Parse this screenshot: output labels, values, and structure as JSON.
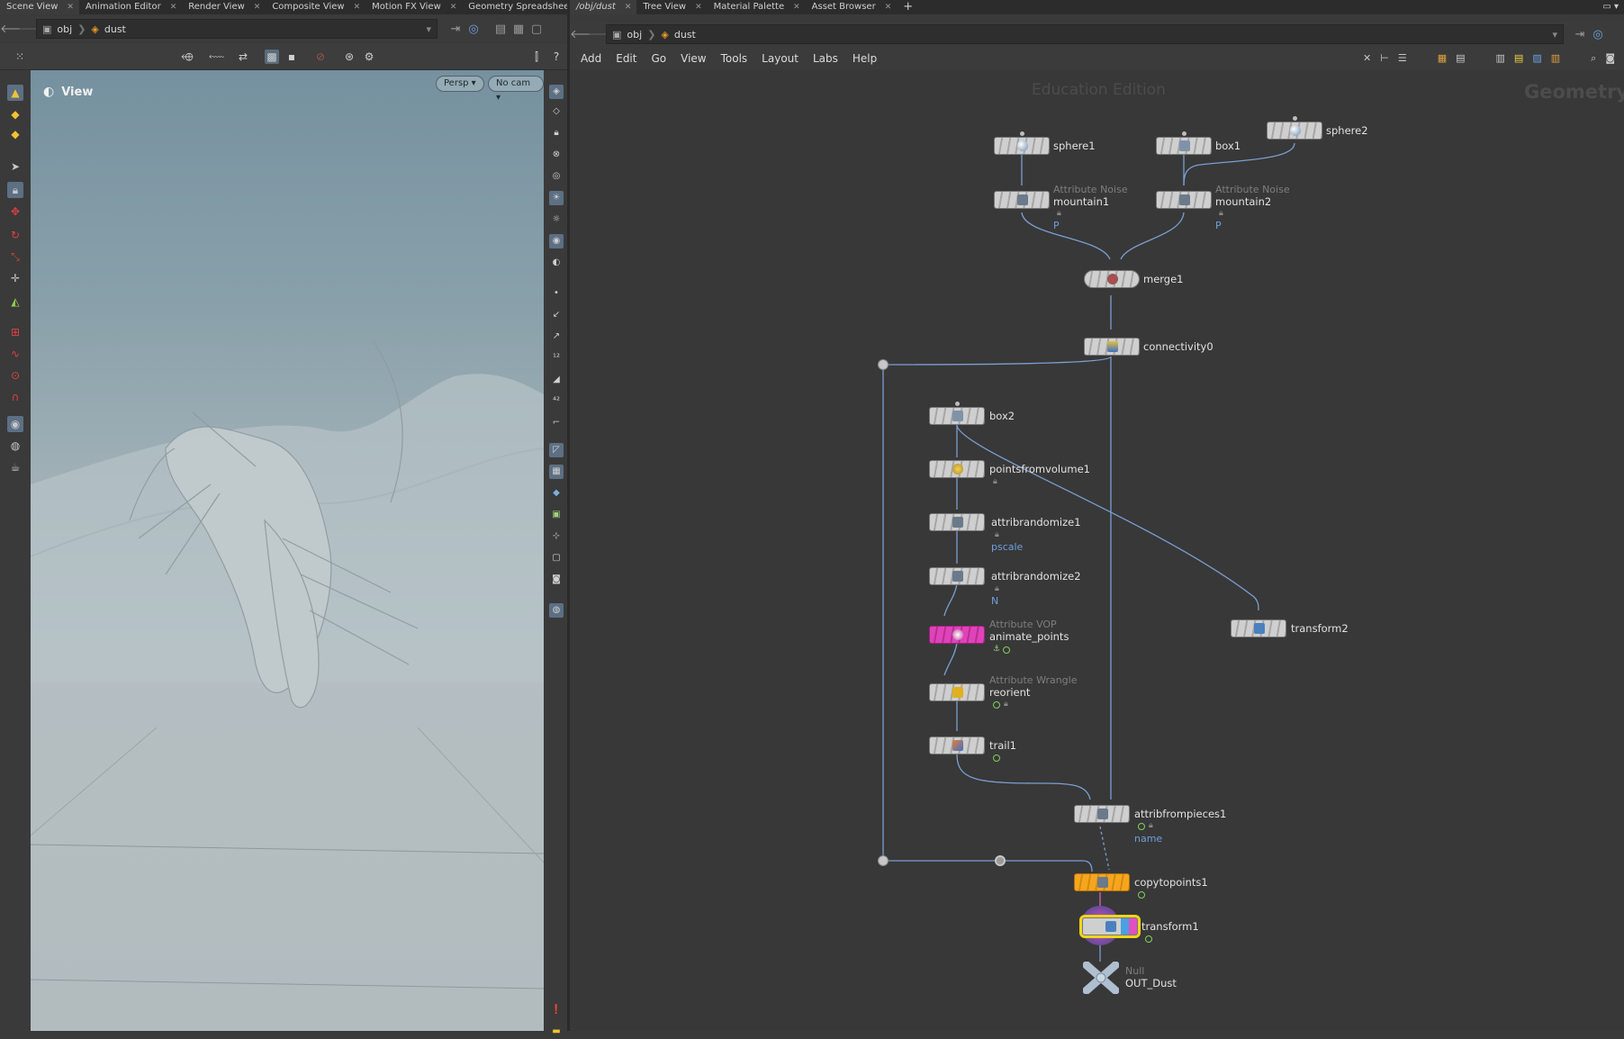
{
  "left_tabs": [
    {
      "label": "Scene View",
      "active": true
    },
    {
      "label": "Animation Editor"
    },
    {
      "label": "Render View"
    },
    {
      "label": "Composite View"
    },
    {
      "label": "Motion FX View"
    },
    {
      "label": "Geometry Spreadsheet"
    }
  ],
  "left_path": {
    "root": "obj",
    "current": "dust"
  },
  "viewport": {
    "title": "View",
    "camera_mode": "Persp",
    "camera": "No cam"
  },
  "right_tabs": [
    {
      "label": "/obj/dust",
      "active": true
    },
    {
      "label": "Tree View"
    },
    {
      "label": "Material Palette"
    },
    {
      "label": "Asset Browser"
    }
  ],
  "right_path": {
    "root": "obj",
    "current": "dust"
  },
  "menu": [
    "Add",
    "Edit",
    "Go",
    "View",
    "Tools",
    "Layout",
    "Labs",
    "Help"
  ],
  "network": {
    "edition": "Education Edition",
    "context": "Geometry",
    "nodes": {
      "sphere1": {
        "name": "sphere1"
      },
      "box1": {
        "name": "box1"
      },
      "sphere2": {
        "name": "sphere2"
      },
      "mountain1": {
        "name": "mountain1",
        "type": "Attribute Noise",
        "param": "P"
      },
      "mountain2": {
        "name": "mountain2",
        "type": "Attribute Noise",
        "param": "P"
      },
      "merge1": {
        "name": "merge1"
      },
      "connectivity0": {
        "name": "connectivity0"
      },
      "box2": {
        "name": "box2"
      },
      "pointsfromvolume1": {
        "name": "pointsfromvolume1"
      },
      "attribrandomize1": {
        "name": "attribrandomize1",
        "param": "pscale"
      },
      "attribrandomize2": {
        "name": "attribrandomize2",
        "param": "N"
      },
      "animate_points": {
        "name": "animate_points",
        "type": "Attribute VOP"
      },
      "reorient": {
        "name": "reorient",
        "type": "Attribute Wrangle"
      },
      "trail1": {
        "name": "trail1"
      },
      "transform2": {
        "name": "transform2"
      },
      "attribfrompieces1": {
        "name": "attribfrompieces1",
        "param": "name"
      },
      "copytopoints1": {
        "name": "copytopoints1"
      },
      "transform1": {
        "name": "transform1"
      },
      "OUT_Dust": {
        "name": "OUT_Dust",
        "type": "Null"
      }
    }
  },
  "colors": {
    "wire": "#7b9fd1",
    "orange_node": "#f6a51e",
    "pink_node": "#e043b9",
    "selected_outline": "#f2d41a",
    "param_text": "#6f9fdc"
  }
}
